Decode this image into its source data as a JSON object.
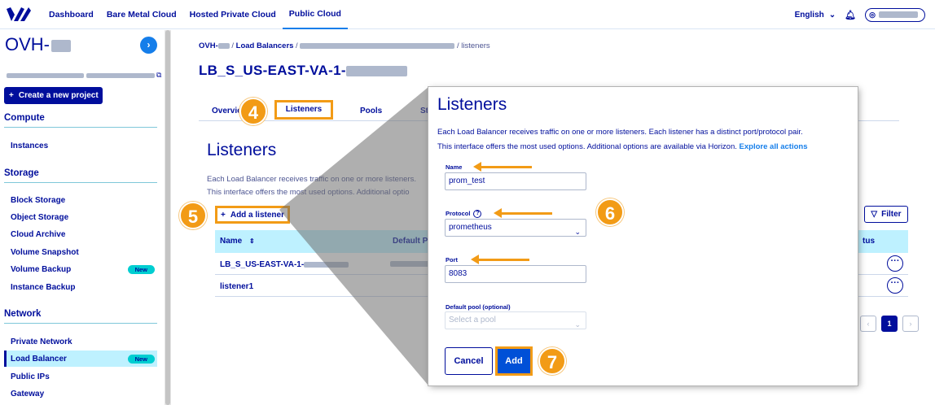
{
  "topbar": {
    "logo_icon": "ovh-logo-icon",
    "nav": [
      "Dashboard",
      "Bare Metal Cloud",
      "Hosted Private Cloud",
      "Public Cloud"
    ],
    "active_nav": "Public Cloud",
    "language": "English",
    "bell_icon": "bell-icon",
    "user_icon": "user-icon"
  },
  "sidebar": {
    "project_title": "OVH-",
    "create_label": "Create a new project",
    "sections": [
      {
        "title": "Compute",
        "items": [
          "Instances"
        ]
      },
      {
        "title": "Storage",
        "items": [
          "Block Storage",
          "Object Storage",
          "Cloud Archive",
          "Volume Snapshot",
          "Volume Backup",
          "Instance Backup"
        ]
      },
      {
        "title": "Network",
        "items": [
          "Private Network",
          "Load Balancer",
          "Public IPs",
          "Gateway"
        ]
      }
    ],
    "new_badge": "New",
    "active_item": "Load Balancer"
  },
  "main": {
    "breadcrumb": {
      "project": "OVH-",
      "lb": "Load Balancers",
      "current": "listeners"
    },
    "lb_title": "LB_S_US-EAST-VA-1-",
    "tabs": [
      "Overview",
      "Listeners",
      "Pools",
      "St"
    ],
    "listeners_title": "Listeners",
    "desc_line1": "Each Load Balancer receives traffic on one or more listeners.",
    "desc_line2": "This interface offers the most used options. Additional optio",
    "add_label": "Add a listener",
    "filter_label": "Filter",
    "table": {
      "headers": {
        "name": "Name",
        "default": "Default P",
        "status": "tus"
      },
      "rows": [
        "LB_S_US-EAST-VA-1-",
        "listener1"
      ]
    },
    "pager": {
      "current": "1"
    }
  },
  "steps": [
    "4",
    "5",
    "6",
    "7"
  ],
  "modal": {
    "title": "Listeners",
    "desc_line1": "Each Load Balancer receives traffic on one or more listeners. Each listener has a distinct port/protocol pair.",
    "desc_line2": "This interface offers the most used options. Additional options are available via Horizon.",
    "desc_link": "Explore all actions",
    "name_label": "Name",
    "name_value": "prom_test",
    "protocol_label": "Protocol",
    "protocol_value": "prometheus",
    "port_label": "Port",
    "port_value": "8083",
    "pool_label": "Default pool (optional)",
    "pool_placeholder": "Select a pool",
    "cancel_label": "Cancel",
    "add_label": "Add"
  },
  "colors": {
    "brand": "#000e9c",
    "accent": "#157eea",
    "highlight": "#f29b16",
    "new_badge": "#00ced1",
    "row_active": "#bef1ff"
  }
}
